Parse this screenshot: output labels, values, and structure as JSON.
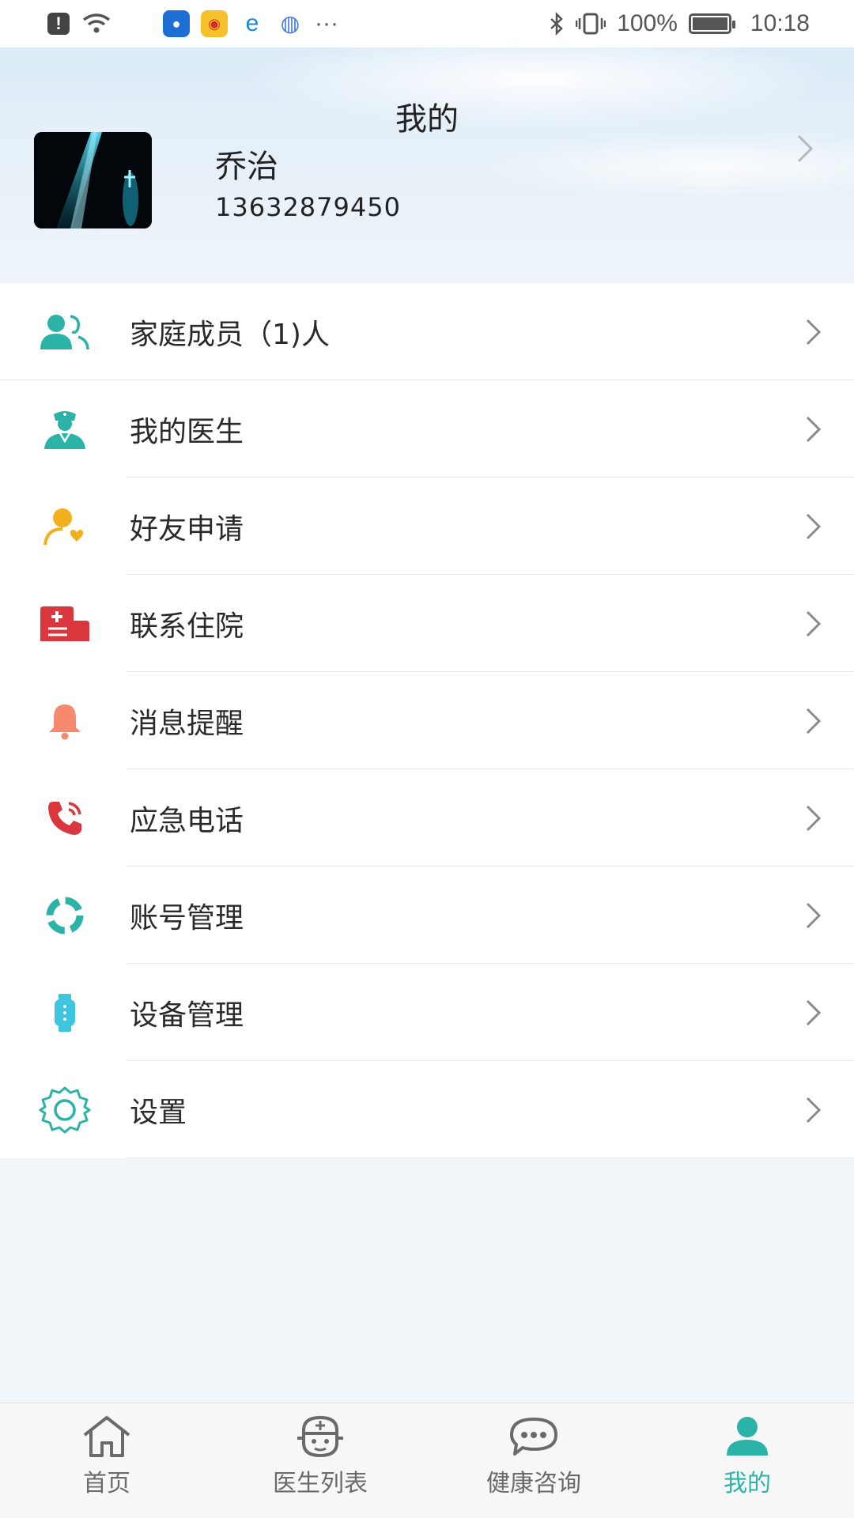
{
  "status_bar": {
    "battery": "100%",
    "time": "10:18",
    "more": "···",
    "notif_apps": [
      "lightbulb-icon",
      "weibo-icon",
      "edge-icon",
      "browser-icon"
    ]
  },
  "header": {
    "title": "我的",
    "user_name": "乔治",
    "phone": "13632879450"
  },
  "menu": [
    {
      "label": "家庭成员（1)人",
      "icon": "family-members-icon",
      "color": "#2bb3a8"
    },
    {
      "label": "我的医生",
      "icon": "doctor-icon",
      "color": "#2bb3a8"
    },
    {
      "label": "好友申请",
      "icon": "friend-request-icon",
      "color": "#f2b01e"
    },
    {
      "label": "联系住院",
      "icon": "hospital-icon",
      "color": "#d9363e"
    },
    {
      "label": "消息提醒",
      "icon": "bell-icon",
      "color": "#f58a6e"
    },
    {
      "label": "应急电话",
      "icon": "phone-icon",
      "color": "#d9363e"
    },
    {
      "label": "账号管理",
      "icon": "account-manage-icon",
      "color": "#2bb3a8"
    },
    {
      "label": "设备管理",
      "icon": "watch-icon",
      "color": "#3ec6e0"
    },
    {
      "label": "设置",
      "icon": "gear-icon",
      "color": "#2bb3a8"
    }
  ],
  "bottom_nav": [
    {
      "label": "首页",
      "icon": "home-icon",
      "active": false
    },
    {
      "label": "医生列表",
      "icon": "doctor-list-icon",
      "active": false
    },
    {
      "label": "健康咨询",
      "icon": "chat-icon",
      "active": false
    },
    {
      "label": "我的",
      "icon": "profile-icon",
      "active": true
    }
  ],
  "colors": {
    "accent": "#2bb3a8",
    "inactive_nav": "#6a6a6a"
  }
}
